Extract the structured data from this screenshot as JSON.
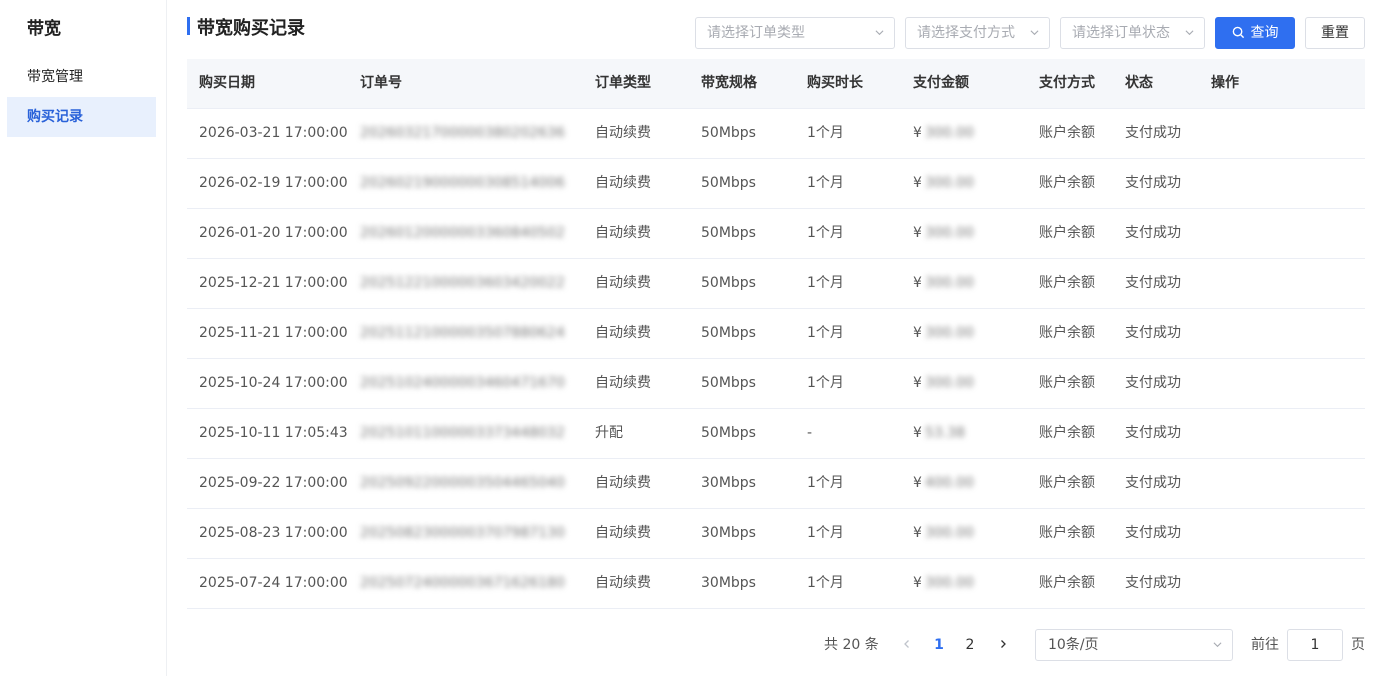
{
  "sidebar": {
    "title": "带宽",
    "items": [
      {
        "label": "带宽管理",
        "active": false
      },
      {
        "label": "购买记录",
        "active": true
      }
    ]
  },
  "page": {
    "title": "带宽购买记录"
  },
  "filters": {
    "order_type_placeholder": "请选择订单类型",
    "pay_method_placeholder": "请选择支付方式",
    "order_status_placeholder": "请选择订单状态",
    "query_label": "查询",
    "reset_label": "重置"
  },
  "table": {
    "headers": [
      "购买日期",
      "订单号",
      "订单类型",
      "带宽规格",
      "购买时长",
      "支付金额",
      "支付方式",
      "状态",
      "操作"
    ],
    "rows": [
      {
        "date": "2026-03-21 17:00:00",
        "order_no": "20260321700000380202636",
        "type": "自动续费",
        "spec": "50Mbps",
        "duration": "1个月",
        "currency": "¥",
        "amount": "300.00",
        "pay": "账户余额",
        "status": "支付成功"
      },
      {
        "date": "2026-02-19 17:00:00",
        "order_no": "20260219000000308514006",
        "type": "自动续费",
        "spec": "50Mbps",
        "duration": "1个月",
        "currency": "¥",
        "amount": "300.00",
        "pay": "账户余额",
        "status": "支付成功"
      },
      {
        "date": "2026-01-20 17:00:00",
        "order_no": "20260120000003360840502",
        "type": "自动续费",
        "spec": "50Mbps",
        "duration": "1个月",
        "currency": "¥",
        "amount": "300.00",
        "pay": "账户余额",
        "status": "支付成功"
      },
      {
        "date": "2025-12-21 17:00:00",
        "order_no": "20251221000003603420022",
        "type": "自动续费",
        "spec": "50Mbps",
        "duration": "1个月",
        "currency": "¥",
        "amount": "300.00",
        "pay": "账户余额",
        "status": "支付成功"
      },
      {
        "date": "2025-11-21 17:00:00",
        "order_no": "20251121000003507880624",
        "type": "自动续费",
        "spec": "50Mbps",
        "duration": "1个月",
        "currency": "¥",
        "amount": "300.00",
        "pay": "账户余额",
        "status": "支付成功"
      },
      {
        "date": "2025-10-24 17:00:00",
        "order_no": "20251024000003460471670",
        "type": "自动续费",
        "spec": "50Mbps",
        "duration": "1个月",
        "currency": "¥",
        "amount": "300.00",
        "pay": "账户余额",
        "status": "支付成功"
      },
      {
        "date": "2025-10-11 17:05:43",
        "order_no": "20251011000003373448032",
        "type": "升配",
        "spec": "50Mbps",
        "duration": "-",
        "currency": "¥",
        "amount": "53.38",
        "pay": "账户余额",
        "status": "支付成功"
      },
      {
        "date": "2025-09-22 17:00:00",
        "order_no": "20250922000003504465040",
        "type": "自动续费",
        "spec": "30Mbps",
        "duration": "1个月",
        "currency": "¥",
        "amount": "400.00",
        "pay": "账户余额",
        "status": "支付成功"
      },
      {
        "date": "2025-08-23 17:00:00",
        "order_no": "20250823000003707987130",
        "type": "自动续费",
        "spec": "30Mbps",
        "duration": "1个月",
        "currency": "¥",
        "amount": "300.00",
        "pay": "账户余额",
        "status": "支付成功"
      },
      {
        "date": "2025-07-24 17:00:00",
        "order_no": "20250724000003671626180",
        "type": "自动续费",
        "spec": "30Mbps",
        "duration": "1个月",
        "currency": "¥",
        "amount": "300.00",
        "pay": "账户余额",
        "status": "支付成功"
      }
    ]
  },
  "pagination": {
    "total_text": "共 20 条",
    "pages": [
      "1",
      "2"
    ],
    "current": "1",
    "page_size": "10条/页",
    "goto_label": "前往",
    "goto_value": "1",
    "goto_suffix": "页"
  }
}
